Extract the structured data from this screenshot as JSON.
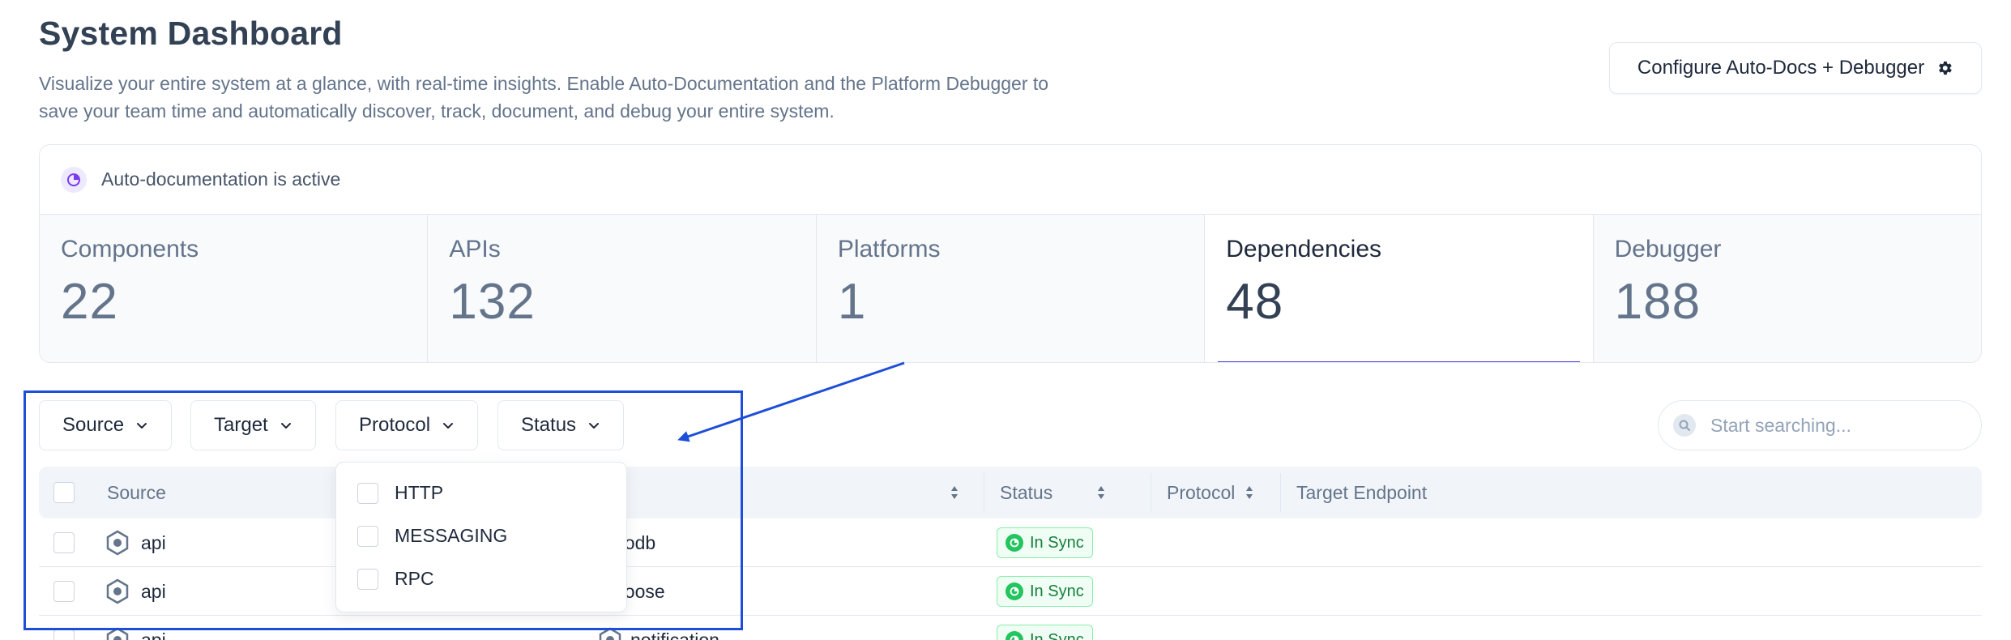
{
  "header": {
    "title": "System Dashboard",
    "description": "Visualize your entire system at a glance, with real-time insights. Enable Auto-Documentation and the Platform Debugger to save your team time and automatically discover, track, document, and debug your entire system.",
    "config_button": "Configure Auto-Docs + Debugger",
    "config_icon": "gear-icon"
  },
  "auto_doc": {
    "text": "Auto-documentation is active",
    "icon": "pie-chart-icon"
  },
  "stats": [
    {
      "label": "Components",
      "value": "22"
    },
    {
      "label": "APIs",
      "value": "132"
    },
    {
      "label": "Platforms",
      "value": "1"
    },
    {
      "label": "Dependencies",
      "value": "48",
      "active": true
    },
    {
      "label": "Debugger",
      "value": "188"
    }
  ],
  "filters": [
    "Source",
    "Target",
    "Protocol",
    "Status"
  ],
  "search": {
    "placeholder": "Start searching..."
  },
  "table": {
    "columns": [
      "Source",
      "Status",
      "Protocol",
      "Target Endpoint"
    ],
    "rows": [
      {
        "source": "api",
        "target": "godb",
        "status": "In Sync"
      },
      {
        "source": "api",
        "target": "goose",
        "status": "In Sync"
      },
      {
        "source": "api",
        "target": "notification",
        "status": "In Sync"
      }
    ]
  },
  "protocol_dropdown": {
    "options": [
      "HTTP",
      "MESSAGING",
      "RPC"
    ]
  },
  "colors": {
    "accent": "#4f46e5",
    "annotation": "#1d4ed8",
    "success": "#15803d"
  }
}
